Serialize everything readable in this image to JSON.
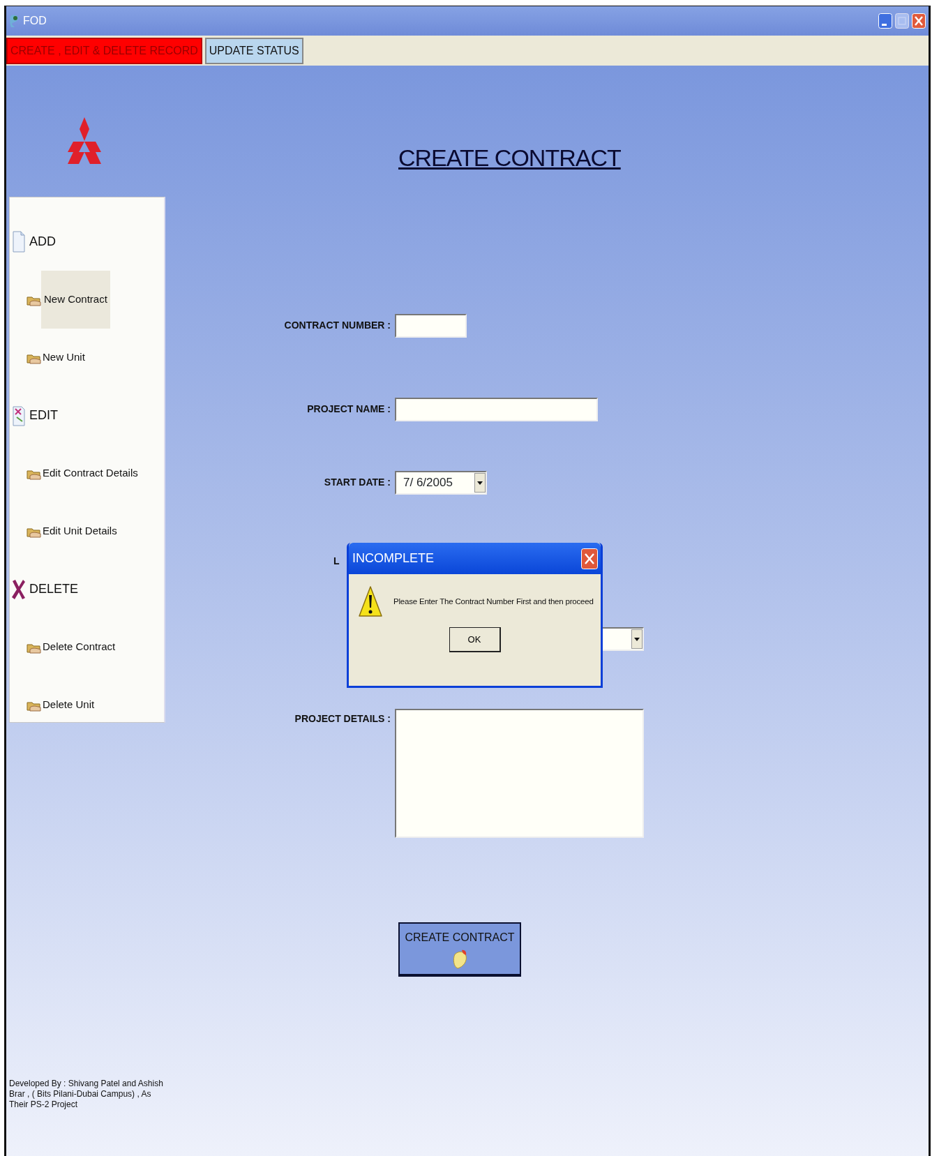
{
  "window": {
    "title": "FOD"
  },
  "tabs": [
    {
      "label": "CREATE , EDIT & DELETE RECORD",
      "selected": true
    },
    {
      "label": "UPDATE STATUS",
      "selected": false
    }
  ],
  "page_title": "CREATE CONTRACT",
  "sidebar": {
    "groups": [
      {
        "label": "ADD",
        "children": [
          {
            "label": "New Contract",
            "selected": true
          },
          {
            "label": "New Unit",
            "selected": false
          }
        ]
      },
      {
        "label": "EDIT",
        "children": [
          {
            "label": "Edit Contract Details",
            "selected": false
          },
          {
            "label": "Edit Unit Details",
            "selected": false
          }
        ]
      },
      {
        "label": "DELETE",
        "children": [
          {
            "label": "Delete Contract",
            "selected": false
          },
          {
            "label": "Delete Unit",
            "selected": false
          }
        ]
      }
    ]
  },
  "form": {
    "fields": [
      {
        "kind": "text",
        "label": "CONTRACT NUMBER :"
      },
      {
        "kind": "text",
        "label": "PROJECT NAME :"
      },
      {
        "kind": "date",
        "label": "START DATE :",
        "value": "7/ 6/2005"
      },
      {
        "kind": "label",
        "label": "L"
      },
      {
        "kind": "dropdown"
      },
      {
        "kind": "textarea",
        "label": "PROJECT DETAILS :"
      }
    ],
    "submit": "CREATE CONTRACT"
  },
  "dialog": {
    "title": "INCOMPLETE",
    "message": "Please Enter The Contract Number First and then proceed",
    "button": "OK"
  },
  "footer": "Developed By : Shivang Patel and Ashish Brar , ( Bits Pilani-Dubai Campus) , As Their PS-2 Project"
}
